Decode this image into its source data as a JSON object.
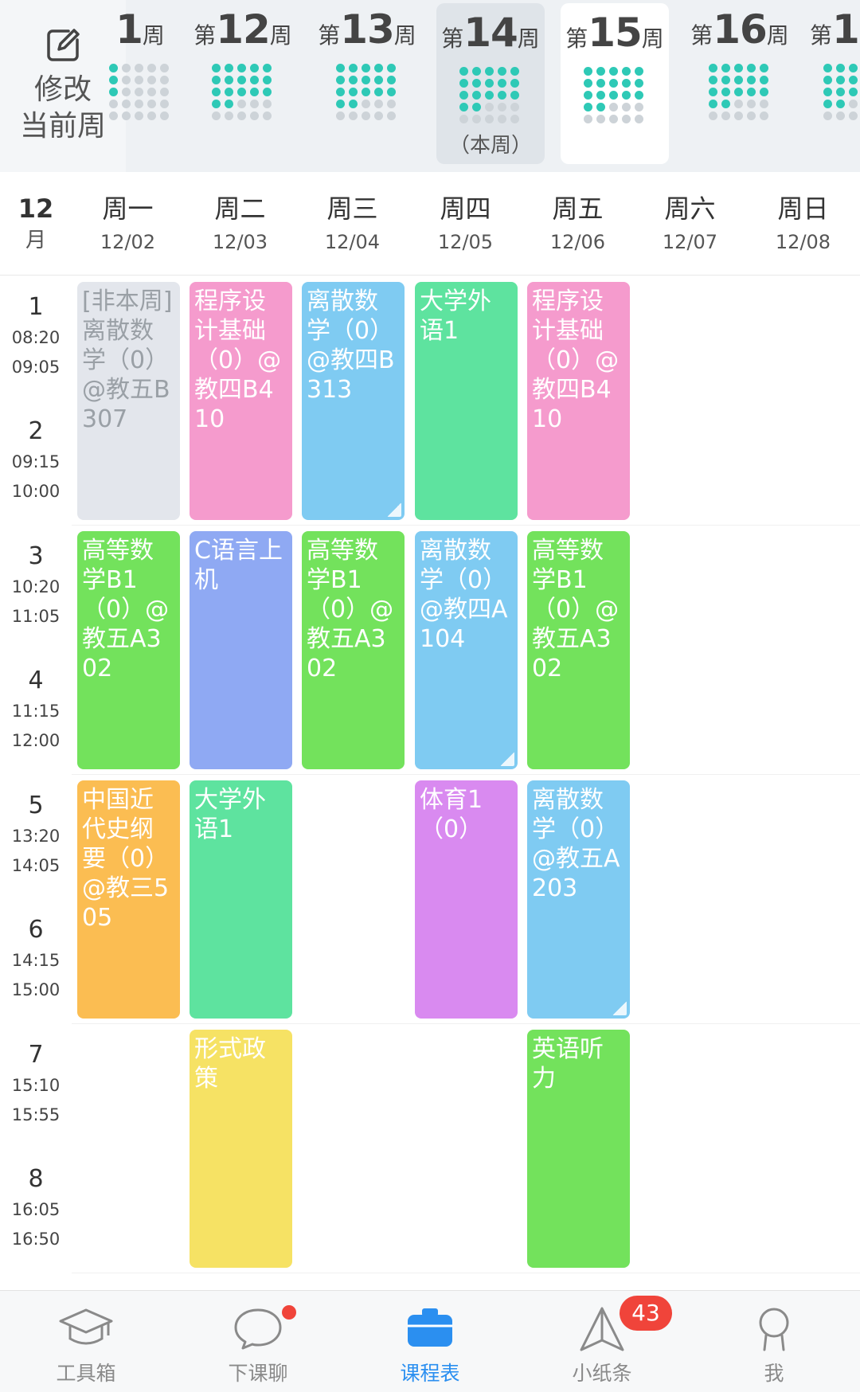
{
  "week_strip": {
    "edit_label_1": "修改",
    "edit_label_2": "当前周",
    "weeks": [
      {
        "pre": "",
        "num": "1",
        "suf": "周",
        "note": ""
      },
      {
        "pre": "第",
        "num": "12",
        "suf": "周",
        "note": ""
      },
      {
        "pre": "第",
        "num": "13",
        "suf": "周",
        "note": ""
      },
      {
        "pre": "第",
        "num": "14",
        "suf": "周",
        "note": "（本周）"
      },
      {
        "pre": "第",
        "num": "15",
        "suf": "周",
        "note": ""
      },
      {
        "pre": "第",
        "num": "16",
        "suf": "周",
        "note": ""
      },
      {
        "pre": "第",
        "num": "1",
        "suf": "",
        "note": ""
      }
    ]
  },
  "day_header": {
    "month_num": "12",
    "month_unit": "月",
    "days": [
      {
        "name": "周一",
        "date": "12/02"
      },
      {
        "name": "周二",
        "date": "12/03"
      },
      {
        "name": "周三",
        "date": "12/04"
      },
      {
        "name": "周四",
        "date": "12/05"
      },
      {
        "name": "周五",
        "date": "12/06"
      },
      {
        "name": "周六",
        "date": "12/07"
      },
      {
        "name": "周日",
        "date": "12/08"
      }
    ]
  },
  "periods": [
    {
      "num": "1",
      "start": "08:20",
      "end": "09:05"
    },
    {
      "num": "2",
      "start": "09:15",
      "end": "10:00"
    },
    {
      "num": "3",
      "start": "10:20",
      "end": "11:05"
    },
    {
      "num": "4",
      "start": "11:15",
      "end": "12:00"
    },
    {
      "num": "5",
      "start": "13:20",
      "end": "14:05"
    },
    {
      "num": "6",
      "start": "14:15",
      "end": "15:00"
    },
    {
      "num": "7",
      "start": "15:10",
      "end": "15:55"
    },
    {
      "num": "8",
      "start": "16:05",
      "end": "16:50"
    }
  ],
  "colors": {
    "gray": "#e3e6ec",
    "pink": "#f59bcd",
    "blue": "#7fcbf2",
    "mint": "#5ee39f",
    "green": "#73e25c",
    "periwinkle": "#8fa9f3",
    "orange": "#fbbd52",
    "purple": "#d98af0",
    "yellow": "#f6e264",
    "accent": "#2b8ff0",
    "teal_dot": "#2ec9b6",
    "badge_red": "#f0443a"
  },
  "courses": [
    {
      "day": 0,
      "start": 1,
      "span": 2,
      "color": "gray",
      "text": "[非本周]离散数学（0）@教五B307"
    },
    {
      "day": 1,
      "start": 1,
      "span": 2,
      "color": "pink",
      "text": "程序设计基础（0）@教四B410"
    },
    {
      "day": 2,
      "start": 1,
      "span": 2,
      "color": "blue",
      "text": "离散数学（0）@教四B313"
    },
    {
      "day": 3,
      "start": 1,
      "span": 2,
      "color": "mint",
      "text": "大学外语1"
    },
    {
      "day": 4,
      "start": 1,
      "span": 2,
      "color": "pink",
      "text": "程序设计基础（0）@教四B410"
    },
    {
      "day": 0,
      "start": 3,
      "span": 2,
      "color": "green",
      "text": "高等数学B1（0）@教五A302"
    },
    {
      "day": 1,
      "start": 3,
      "span": 2,
      "color": "periwinkle",
      "text": "C语言上机"
    },
    {
      "day": 2,
      "start": 3,
      "span": 2,
      "color": "green",
      "text": "高等数学B1（0）@教五A302"
    },
    {
      "day": 3,
      "start": 3,
      "span": 2,
      "color": "blue",
      "text": "离散数学（0）@教四A104"
    },
    {
      "day": 4,
      "start": 3,
      "span": 2,
      "color": "green",
      "text": "高等数学B1（0）@教五A302"
    },
    {
      "day": 0,
      "start": 5,
      "span": 2,
      "color": "orange",
      "text": "中国近代史纲要（0）@教三505"
    },
    {
      "day": 1,
      "start": 5,
      "span": 2,
      "color": "mint",
      "text": "大学外语1"
    },
    {
      "day": 3,
      "start": 5,
      "span": 2,
      "color": "purple",
      "text": "体育1（0）"
    },
    {
      "day": 4,
      "start": 5,
      "span": 2,
      "color": "blue",
      "text": "离散数学（0）@教五A203"
    },
    {
      "day": 1,
      "start": 7,
      "span": 2,
      "color": "yellow",
      "text": "形式政策"
    },
    {
      "day": 4,
      "start": 7,
      "span": 2,
      "color": "green",
      "text": "英语听力"
    }
  ],
  "tabbar": {
    "tabs": [
      {
        "label": "工具箱",
        "icon": "graduation-cap-icon"
      },
      {
        "label": "下课聊",
        "icon": "chat-bubble-icon"
      },
      {
        "label": "课程表",
        "icon": "briefcase-icon"
      },
      {
        "label": "小纸条",
        "icon": "paper-plane-icon"
      },
      {
        "label": "我",
        "icon": "person-icon"
      }
    ],
    "notes_badge": "43"
  }
}
